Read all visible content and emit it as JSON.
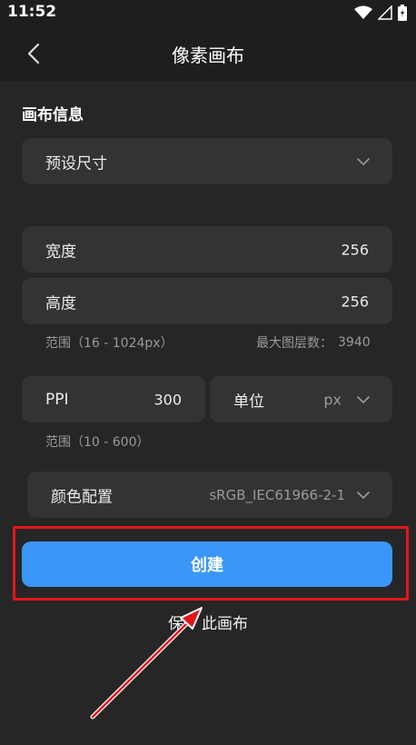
{
  "status": {
    "time": "11:52"
  },
  "header": {
    "title": "像素画布"
  },
  "section": {
    "title": "画布信息"
  },
  "preset": {
    "label": "预设尺寸"
  },
  "width": {
    "label": "宽度",
    "value": "256"
  },
  "height": {
    "label": "高度",
    "value": "256"
  },
  "range_hint": "范围（16 - 1024px）",
  "max_layers": {
    "label": "最大图层数：",
    "value": "3940"
  },
  "ppi": {
    "label": "PPI",
    "value": "300",
    "range": "范围（10 - 600）"
  },
  "unit": {
    "label": "单位",
    "value": "px"
  },
  "color_profile": {
    "label": "颜色配置",
    "value": "sRGB_IEC61966-2-1"
  },
  "create_button": {
    "label": "创建"
  },
  "save_canvas": {
    "label": "保存此画布",
    "visible_text_left": "保",
    "visible_text_right": "此画布"
  },
  "colors": {
    "accent": "#3a96f7",
    "highlight": "#e4161c"
  }
}
